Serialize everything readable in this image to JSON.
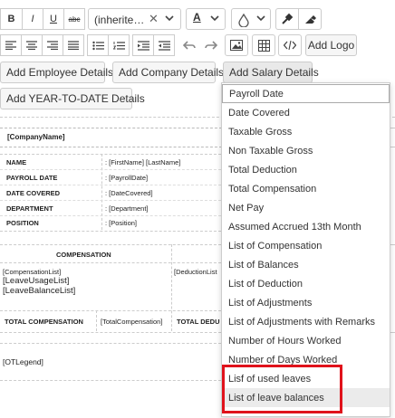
{
  "toolbar": {
    "bold": "B",
    "italic": "I",
    "underline": "U",
    "strike": "abc",
    "font_value": "(inherite…",
    "font_color_letter": "A",
    "add_logo": "Add Logo"
  },
  "insert_buttons": {
    "employee": "Add Employee Details",
    "company": "Add Company Details",
    "salary": "Add Salary Details",
    "ytd": "Add YEAR-TO-DATE Details"
  },
  "document": {
    "company_name": "[CompanyName]",
    "rows": [
      {
        "label": "NAME",
        "value": ": [FirstName] [LastName]"
      },
      {
        "label": "PAYROLL DATE",
        "value": ": [PayrollDate]"
      },
      {
        "label": "DATE COVERED",
        "value": ": [DateCovered]"
      },
      {
        "label": "DEPARTMENT",
        "value": ": [Department]"
      },
      {
        "label": "POSITION",
        "value": ": [Position]"
      }
    ],
    "compensation_header": "COMPENSATION",
    "compensation_list": "[CompensationList]",
    "leave_usage_list": "[LeaveUsageList]",
    "leave_balance_list": "[LeaveBalanceList]",
    "deduction_list": "[DeductionList",
    "total_compensation_label": "TOTAL COMPENSATION",
    "total_compensation_value": "[TotalCompensation]",
    "total_deduction_label": "TOTAL DEDU",
    "ot_legend": "[OTLegend]"
  },
  "salary_menu": {
    "items": [
      "Payroll Date",
      "Date Covered",
      "Taxable Gross",
      "Non Taxable Gross",
      "Total Deduction",
      "Total Compensation",
      "Net Pay",
      "Assumed Accrued 13th Month",
      "List of Compensation",
      "List of Balances",
      "List of Deduction",
      "List of Adjustments",
      "List of Adjustments with Remarks",
      "Number of Hours Worked",
      "Number of Days Worked",
      "Lisf of used leaves",
      "List of leave balances"
    ]
  },
  "colors": {
    "highlight_box": "#e0121b",
    "hover_bg": "#ebebeb"
  }
}
